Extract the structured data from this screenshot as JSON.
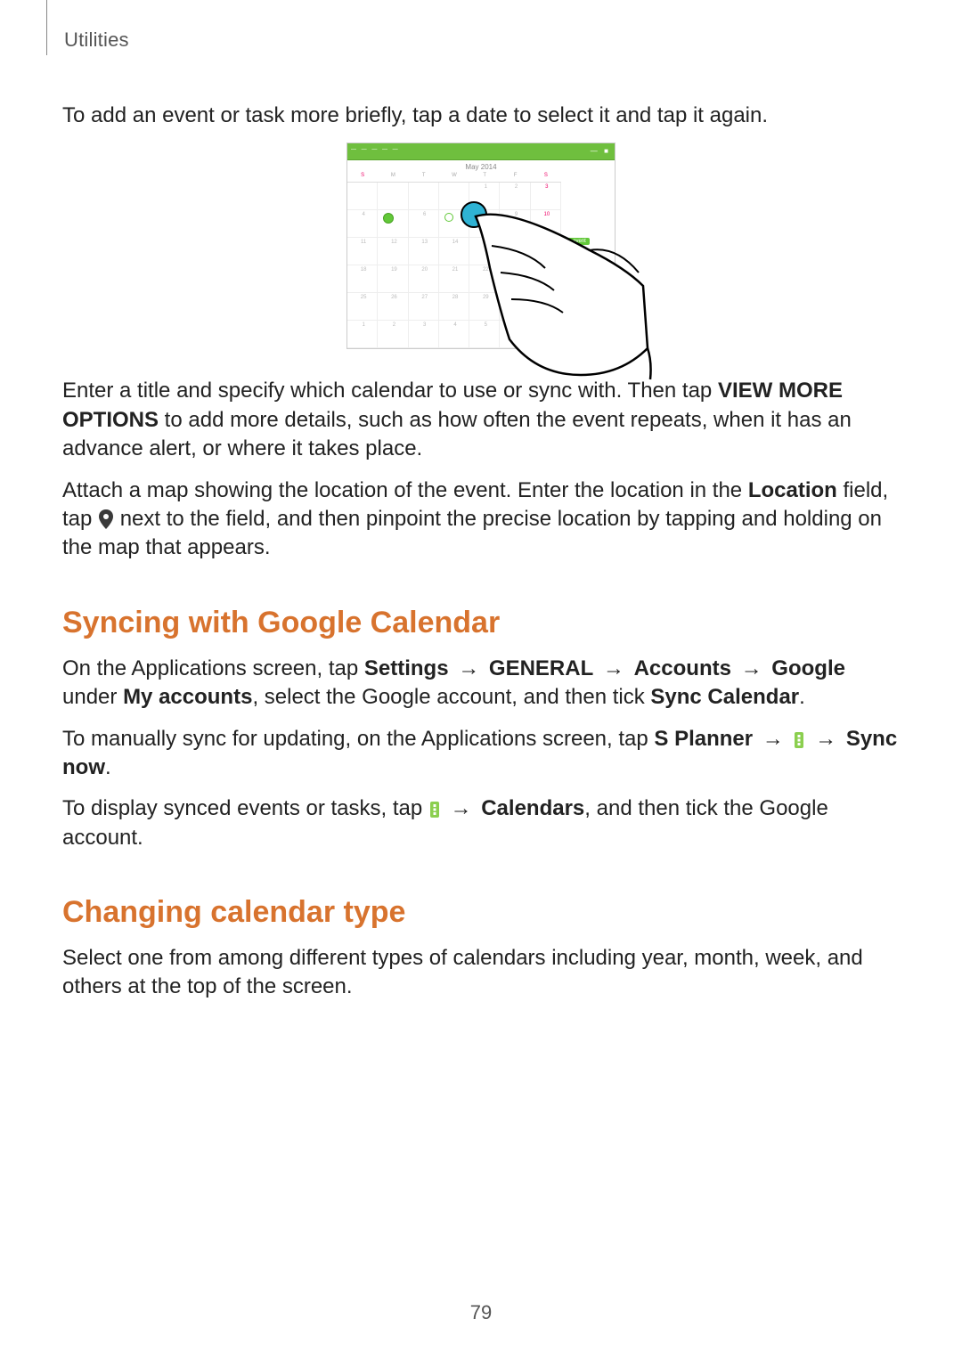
{
  "header": {
    "section": "Utilities"
  },
  "intro": "To add an event or task more briefly, tap a date to select it and tap it again.",
  "figure": {
    "month": "May 2014",
    "dow": [
      "S",
      "M",
      "T",
      "W",
      "T",
      "F",
      "S"
    ],
    "new_event": "+ event"
  },
  "p2a": "Enter a title and specify which calendar to use or sync with. Then tap ",
  "p2b": "VIEW MORE OPTIONS",
  "p2c": " to add more details, such as how often the event repeats, when it has an advance alert, or where it takes place.",
  "p3a": "Attach a map showing the location of the event. Enter the location in the ",
  "p3b": "Location",
  "p3c": " field, tap ",
  "p3d": " next to the field, and then pinpoint the precise location by tapping and holding on the map that appears.",
  "h_sync": "Syncing with Google Calendar",
  "p4a": "On the Applications screen, tap ",
  "p4b": "Settings",
  "p4c": "GENERAL",
  "p4d": "Accounts",
  "p4e": "Google",
  "p4f": " under ",
  "p4g": "My accounts",
  "p4h": ", select the Google account, and then tick ",
  "p4i": "Sync Calendar",
  "p4j": ".",
  "arrow": " → ",
  "p5a": "To manually sync for updating, on the Applications screen, tap ",
  "p5b": "S Planner",
  "p5c": "Sync now",
  "p5d": ".",
  "p6a": "To display synced events or tasks, tap ",
  "p6b": "Calendars",
  "p6c": ", and then tick the Google account.",
  "h_change": "Changing calendar type",
  "p7": "Select one from among different types of calendars including year, month, week, and others at the top of the screen.",
  "page_number": "79"
}
